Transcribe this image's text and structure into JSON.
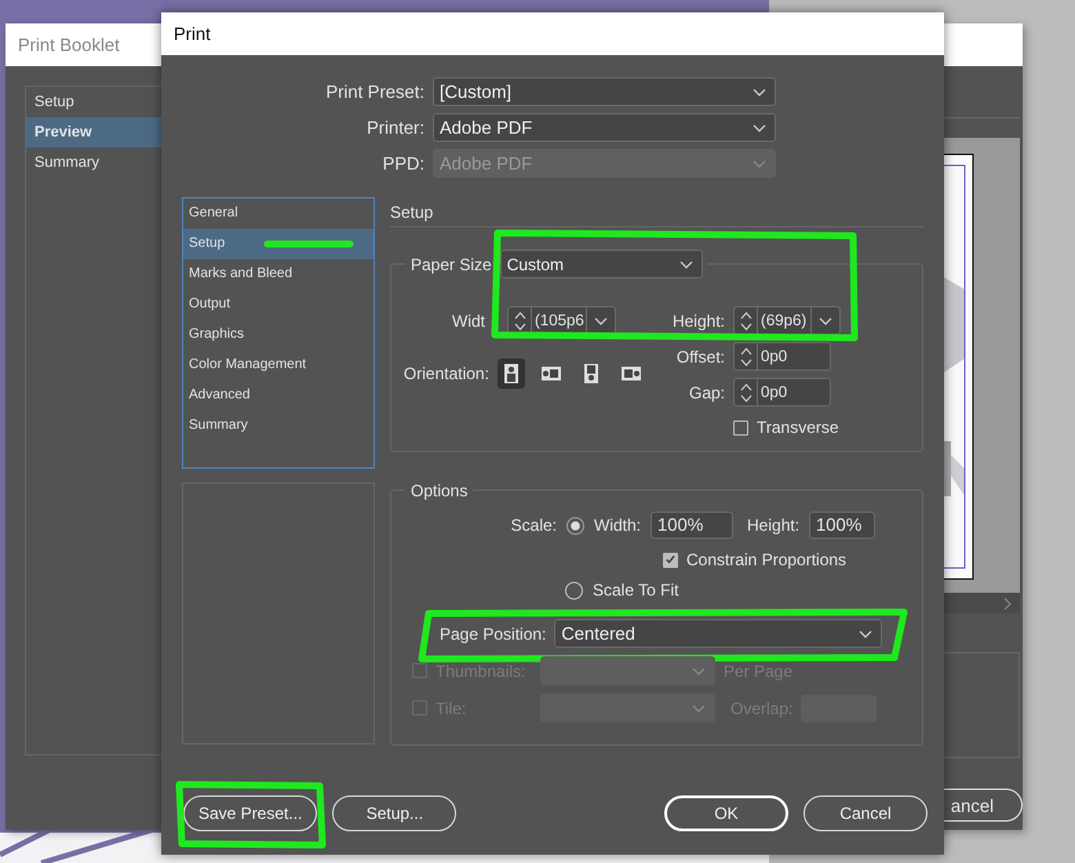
{
  "booklet_window": {
    "title": "Print Booklet",
    "sidebar": [
      {
        "label": "Setup",
        "selected": false
      },
      {
        "label": "Preview",
        "selected": true
      },
      {
        "label": "Summary",
        "selected": false
      }
    ],
    "cancel_button": "ancel"
  },
  "print_dialog": {
    "title": "Print",
    "top_fields": [
      {
        "label": "Print Preset:",
        "value": "[Custom]",
        "disabled": false
      },
      {
        "label": "Printer:",
        "value": "Adobe PDF",
        "disabled": false
      },
      {
        "label": "PPD:",
        "value": "Adobe PDF",
        "disabled": true
      }
    ],
    "categories": [
      {
        "label": "General",
        "selected": false,
        "marked": false
      },
      {
        "label": "Setup",
        "selected": true,
        "marked": true
      },
      {
        "label": "Marks and Bleed",
        "selected": false,
        "marked": false
      },
      {
        "label": "Output",
        "selected": false,
        "marked": false
      },
      {
        "label": "Graphics",
        "selected": false,
        "marked": false
      },
      {
        "label": "Color Management",
        "selected": false,
        "marked": false
      },
      {
        "label": "Advanced",
        "selected": false,
        "marked": false
      },
      {
        "label": "Summary",
        "selected": false,
        "marked": false
      }
    ],
    "section_title": "Setup",
    "paper_size": {
      "legend": "Paper Size",
      "value": "Custom",
      "highlighted": true,
      "width_label": "Widt",
      "width_value": "(105p6",
      "height_label": "Height:",
      "height_value": "(69p6)",
      "orientation_label": "Orientation:",
      "orientations": [
        {
          "kind": "portrait",
          "selected": true
        },
        {
          "kind": "landscape",
          "selected": false
        },
        {
          "kind": "reverse-portrait",
          "selected": false
        },
        {
          "kind": "reverse-landscape",
          "selected": false
        }
      ],
      "offset_label": "Offset:",
      "offset_value": "0p0",
      "gap_label": "Gap:",
      "gap_value": "0p0",
      "transverse": {
        "label": "Transverse",
        "checked": false
      }
    },
    "options": {
      "legend": "Options",
      "scale_label": "Scale:",
      "scale_width": {
        "label": "Width:",
        "selected": true
      },
      "width_value": "100%",
      "height_label": "Height:",
      "height_value": "100%",
      "constrain": {
        "label": "Constrain Proportions",
        "checked": true
      },
      "scale_to_fit": {
        "label": "Scale To Fit",
        "selected": false
      },
      "page_position": {
        "label": "Page Position:",
        "value": "Centered",
        "highlighted": true
      },
      "thumbnails": {
        "label": "Thumbnails:",
        "checked": false,
        "suffix": "Per Page"
      },
      "tile": {
        "label": "Tile:",
        "checked": false,
        "overlap_label": "Overlap:"
      }
    },
    "buttons_left": [
      {
        "label": "Save Preset...",
        "highlighted": true
      },
      {
        "label": "Setup...",
        "highlighted": false
      }
    ],
    "buttons_right": [
      {
        "label": "OK",
        "default": true
      },
      {
        "label": "Cancel",
        "default": false
      }
    ]
  }
}
